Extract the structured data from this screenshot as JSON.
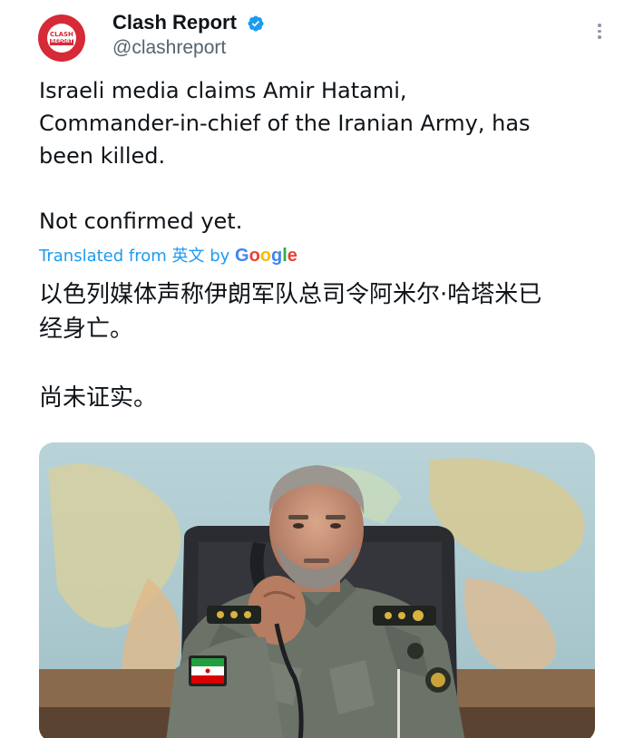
{
  "author": {
    "display_name": "Clash Report",
    "handle": "@clashreport",
    "avatar_text_top": "CLASH",
    "avatar_text_bottom": "REPORT",
    "brand_color": "#d62a36",
    "verified_icon": "verified-badge-icon"
  },
  "tweet": {
    "text": "Israeli media claims Amir Hatami,\nCommander-in-chief of the Iranian Army, has\nbeen killed.\n\nNot confirmed yet.",
    "translation_prefix": "Translated from 英文 by ",
    "translation_provider": {
      "g1": "G",
      "o1": "o",
      "o2": "o",
      "g2": "g",
      "l": "l",
      "e": "e"
    },
    "translated_text": "以色列媒体声称伊朗军队总司令阿米尔·哈塔米已\n经身亡。\n\n尚未证实。"
  },
  "colors": {
    "link": "#1d9bf0",
    "secondary_text": "#536471"
  },
  "media": {
    "kind": "photo"
  },
  "icons": {
    "more": "more-options-icon"
  }
}
